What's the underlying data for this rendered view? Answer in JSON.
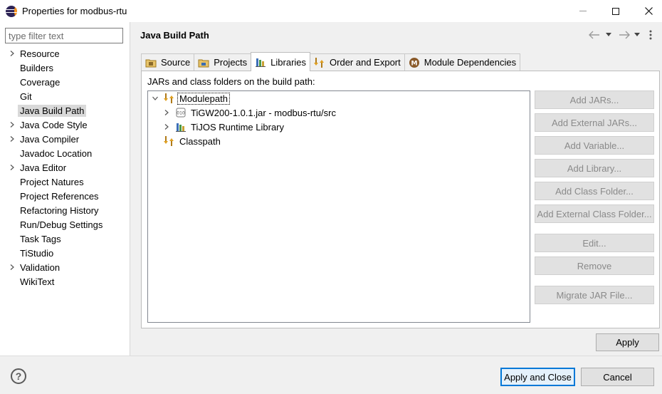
{
  "window": {
    "title": "Properties for modbus-rtu",
    "controls": [
      "minimize",
      "maximize",
      "close"
    ]
  },
  "filter": {
    "placeholder": "type filter text",
    "value": ""
  },
  "nav": {
    "items": [
      {
        "label": "Resource",
        "expandable": true,
        "selected": false
      },
      {
        "label": "Builders",
        "expandable": false,
        "selected": false
      },
      {
        "label": "Coverage",
        "expandable": false,
        "selected": false
      },
      {
        "label": "Git",
        "expandable": false,
        "selected": false
      },
      {
        "label": "Java Build Path",
        "expandable": false,
        "selected": true
      },
      {
        "label": "Java Code Style",
        "expandable": true,
        "selected": false
      },
      {
        "label": "Java Compiler",
        "expandable": true,
        "selected": false
      },
      {
        "label": "Javadoc Location",
        "expandable": false,
        "selected": false
      },
      {
        "label": "Java Editor",
        "expandable": true,
        "selected": false
      },
      {
        "label": "Project Natures",
        "expandable": false,
        "selected": false
      },
      {
        "label": "Project References",
        "expandable": false,
        "selected": false
      },
      {
        "label": "Refactoring History",
        "expandable": false,
        "selected": false
      },
      {
        "label": "Run/Debug Settings",
        "expandable": false,
        "selected": false
      },
      {
        "label": "Task Tags",
        "expandable": false,
        "selected": false
      },
      {
        "label": "TiStudio",
        "expandable": false,
        "selected": false
      },
      {
        "label": "Validation",
        "expandable": true,
        "selected": false
      },
      {
        "label": "WikiText",
        "expandable": false,
        "selected": false
      }
    ]
  },
  "page": {
    "title": "Java Build Path",
    "tabs": [
      {
        "label": "Source",
        "icon": "source-folder-icon",
        "active": false
      },
      {
        "label": "Projects",
        "icon": "projects-icon",
        "active": false
      },
      {
        "label": "Libraries",
        "icon": "libraries-icon",
        "active": true
      },
      {
        "label": "Order and Export",
        "icon": "order-export-icon",
        "active": false
      },
      {
        "label": "Module Dependencies",
        "icon": "module-dependencies-icon",
        "active": false
      }
    ],
    "paths_label": "JARs and class folders on the build path:",
    "tree": [
      {
        "label": "Modulepath",
        "icon": "modulepath-icon",
        "expanded": true
      },
      {
        "label": "TiGW200-1.0.1.jar - modbus-rtu/src",
        "icon": "jar-icon",
        "expanded": false
      },
      {
        "label": "TiJOS Runtime Library",
        "icon": "library-icon",
        "expanded": false
      },
      {
        "label": "Classpath",
        "icon": "classpath-icon",
        "expanded": false
      }
    ],
    "buttons": {
      "add_jars": "Add JARs...",
      "add_external_jars": "Add External JARs...",
      "add_variable": "Add Variable...",
      "add_library": "Add Library...",
      "add_class_folder": "Add Class Folder...",
      "add_external_class_folder": "Add External Class Folder...",
      "edit": "Edit...",
      "remove": "Remove",
      "migrate_jar": "Migrate JAR File..."
    },
    "apply": "Apply"
  },
  "footer": {
    "help": "?",
    "apply_and_close": "Apply and Close",
    "cancel": "Cancel"
  }
}
